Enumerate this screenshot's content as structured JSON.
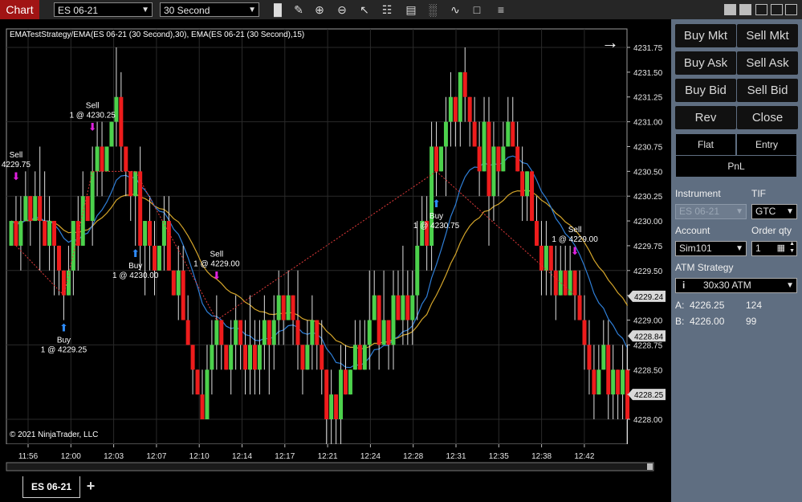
{
  "toolbar": {
    "chart_label": "Chart",
    "instrument": "ES 06-21",
    "interval": "30 Second"
  },
  "chart": {
    "indicator_label": "EMATestStrategy/EMA(ES 06-21 (30 Second),30), EMA(ES 06-21 (30 Second),15)",
    "copyright": "© 2021 NinjaTrader, LLC",
    "price_ticks": [
      "4231.75",
      "4231.50",
      "4231.25",
      "4231.00",
      "4230.75",
      "4230.50",
      "4230.25",
      "4230.00",
      "4229.75",
      "4229.50",
      "4229.25",
      "4229.00",
      "4228.75",
      "4228.50",
      "4228.25",
      "4228.00"
    ],
    "price_tick_values": [
      4231.75,
      4231.5,
      4231.25,
      4231.0,
      4230.75,
      4230.5,
      4230.25,
      4230.0,
      4229.75,
      4229.5,
      4229.25,
      4229.0,
      4228.75,
      4228.5,
      4228.25,
      4228.0
    ],
    "time_ticks": [
      "11:56",
      "12:00",
      "12:03",
      "12:07",
      "12:10",
      "12:14",
      "12:17",
      "12:21",
      "12:24",
      "12:28",
      "12:31",
      "12:35",
      "12:38",
      "12:42"
    ],
    "price_markers": [
      {
        "label": "4229.24",
        "value": 4229.24
      },
      {
        "label": "4228.84",
        "value": 4228.84
      },
      {
        "label": "4228.25",
        "value": 4228.25
      }
    ],
    "trade_signals": [
      {
        "type": "sell",
        "line1": "Sell",
        "line2": "4229.75",
        "index": 1
      },
      {
        "type": "buy",
        "line1": "Buy",
        "line2": "1 @ 4229.25",
        "index": 11
      },
      {
        "type": "sell",
        "line1": "Sell",
        "line2": "1 @ 4230.25",
        "index": 17
      },
      {
        "type": "buy",
        "line1": "Buy",
        "line2": "1 @ 4230.00",
        "index": 26
      },
      {
        "type": "sell",
        "line1": "Sell",
        "line2": "1 @ 4229.00",
        "index": 43
      },
      {
        "type": "buy",
        "line1": "Buy",
        "line2": "1 @ 4230.75",
        "index": 89
      },
      {
        "type": "sell",
        "line1": "Sell",
        "line2": "1 @ 4229.00",
        "index": 118
      }
    ],
    "colors": {
      "up": "#4cd14c",
      "down": "#ee1c1c",
      "ema15": "#2f7fd8",
      "ema30": "#d4a52a",
      "signal": "#e020e0",
      "buy_arrow": "#2e8cff"
    }
  },
  "bottom_tabs": [
    {
      "label": "ES 06-21"
    }
  ],
  "chart_trader": {
    "buttons": [
      "Buy Mkt",
      "Sell Mkt",
      "Buy Ask",
      "Sell Ask",
      "Buy Bid",
      "Sell Bid",
      "Rev",
      "Close"
    ],
    "position": {
      "flat": "Flat",
      "entry": "Entry",
      "pnl": "PnL"
    },
    "instrument_label": "Instrument",
    "instrument_value": "ES 06-21",
    "tif_label": "TIF",
    "tif_value": "GTC",
    "account_label": "Account",
    "account_value": "Sim101",
    "order_qty_label": "Order qty",
    "order_qty_value": "1",
    "atm_label": "ATM Strategy",
    "atm_value": "30x30 ATM",
    "ask_label": "A:",
    "ask_price": "4226.25",
    "ask_size": "124",
    "bid_label": "B:",
    "bid_price": "4226.00",
    "bid_size": "99"
  }
}
